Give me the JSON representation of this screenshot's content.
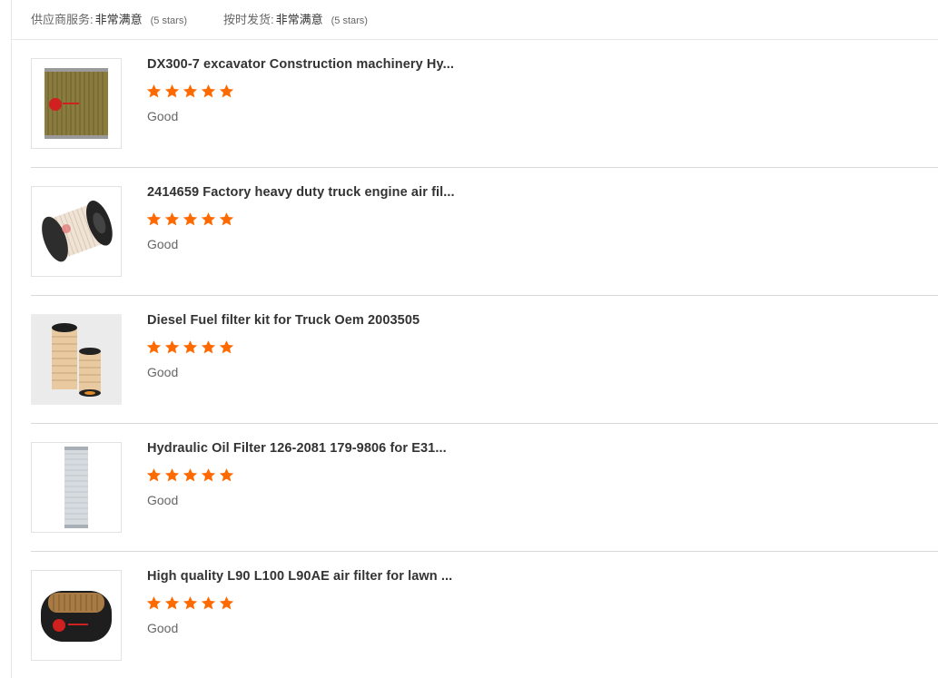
{
  "ratings": {
    "supplier_service": {
      "label": "供应商服务:",
      "value": "非常满意",
      "stars": "(5 stars)"
    },
    "on_time_shipment": {
      "label": "按时发货:",
      "value": "非常满意",
      "stars": "(5 stars)"
    }
  },
  "accent_color": "#ff6a00",
  "reviews": [
    {
      "title": "DX300-7 excavator Construction machinery Hy...",
      "rating": 5,
      "comment": "Good",
      "image_icon": "cylindrical-paper-filter"
    },
    {
      "title": "2414659 Factory heavy duty truck engine air fil...",
      "rating": 5,
      "comment": "Good",
      "image_icon": "air-filter-cartridge"
    },
    {
      "title": "Diesel Fuel filter kit for Truck Oem 2003505",
      "rating": 5,
      "comment": "Good",
      "image_icon": "fuel-filter-kit"
    },
    {
      "title": "Hydraulic Oil Filter 126-2081 179-9806 for E31...",
      "rating": 5,
      "comment": "Good",
      "image_icon": "mesh-hydraulic-filter"
    },
    {
      "title": "High quality L90 L100 L90AE air filter for lawn ...",
      "rating": 5,
      "comment": "Good",
      "image_icon": "oval-air-filter"
    }
  ]
}
